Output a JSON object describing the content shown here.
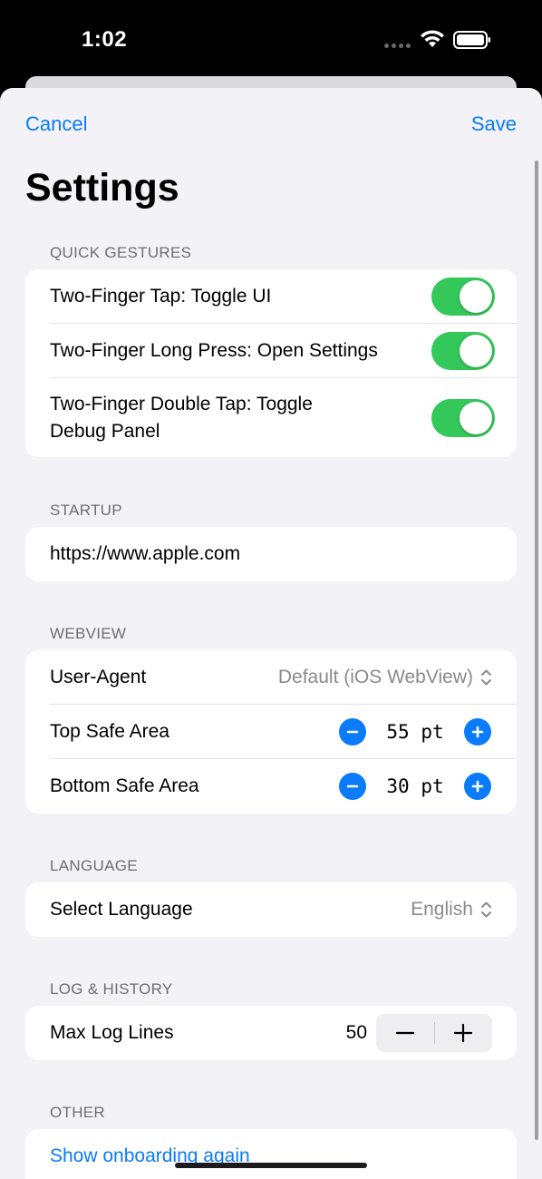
{
  "status_bar": {
    "time": "1:02"
  },
  "nav": {
    "cancel_label": "Cancel",
    "save_label": "Save"
  },
  "title": "Settings",
  "sections": {
    "quick_gestures": {
      "header": "QUICK GESTURES",
      "items": [
        {
          "label": "Two-Finger Tap: Toggle UI",
          "on": true
        },
        {
          "label": "Two-Finger Long Press: Open Settings",
          "on": true
        },
        {
          "label_line1": "Two-Finger Double Tap: Toggle",
          "label_line2": "Debug Panel",
          "on": true
        }
      ]
    },
    "startup": {
      "header": "STARTUP",
      "url": "https://www.apple.com"
    },
    "webview": {
      "header": "WEBVIEW",
      "user_agent_label": "User-Agent",
      "user_agent_value": "Default (iOS WebView)",
      "top_safe_label": "Top Safe Area",
      "top_safe_value": "55 pt",
      "bottom_safe_label": "Bottom Safe Area",
      "bottom_safe_value": "30 pt"
    },
    "language": {
      "header": "LANGUAGE",
      "label": "Select Language",
      "value": "English"
    },
    "log_history": {
      "header": "LOG & HISTORY",
      "label": "Max Log Lines",
      "value": "50"
    },
    "other": {
      "header": "OTHER",
      "onboarding_link": "Show onboarding again"
    }
  },
  "colors": {
    "accent": "#0a7bfb",
    "toggle_on": "#34c759",
    "background": "#f2f2f7"
  },
  "icons": [
    "wifi-icon",
    "battery-icon",
    "chevron-up-down-icon",
    "minus-icon",
    "plus-icon"
  ]
}
